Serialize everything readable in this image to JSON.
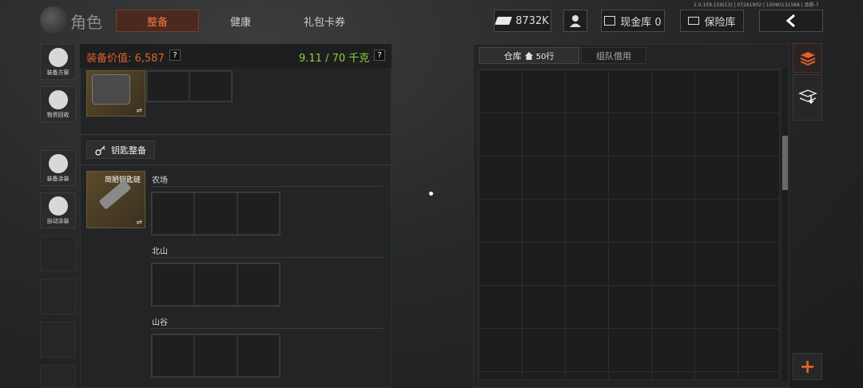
{
  "version": "1.0.159.159(13) | 07261902 | 10060131568 | 品质-7",
  "header": {
    "title": "角色",
    "tabs": [
      "整备",
      "健康",
      "礼包卡券"
    ],
    "active_tab": 0,
    "cash": "8732K",
    "cash_vault": "现金库 0",
    "safe_box": "保险库"
  },
  "sidebar": {
    "items": [
      {
        "label": "装备方案",
        "icon": "gear-plan-icon"
      },
      {
        "label": "物资回收",
        "icon": "recycle-icon"
      },
      {
        "label": "装备涂装",
        "icon": "paint-icon"
      },
      {
        "label": "自动涂装",
        "icon": "auto-paint-icon"
      }
    ]
  },
  "loadout": {
    "value_label": "装备价值: 6,587",
    "weight": "9.11 / 70 千克",
    "help": "?",
    "key_section": "钥匙整备",
    "key_item_name": "简陋钥匙链",
    "swap": "⇌",
    "maps": [
      "农场",
      "北山",
      "山谷"
    ]
  },
  "warehouse": {
    "tab_main": "仓库",
    "rows": "50行",
    "tab_team": "组队借用",
    "add": "+"
  },
  "colors": {
    "accent": "#e0602c",
    "weight": "#8fcf3a",
    "active_tab_bg": "#4a2a20"
  }
}
